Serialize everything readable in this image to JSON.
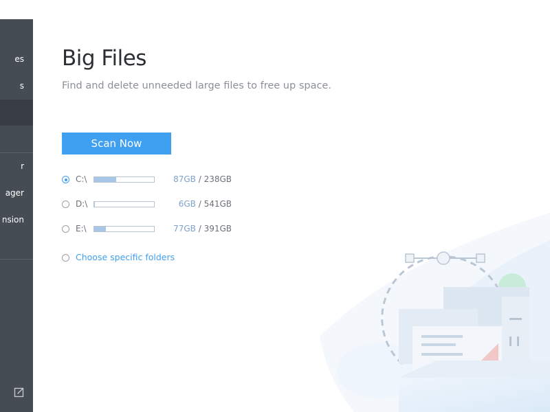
{
  "sidebar": {
    "items": [
      {
        "label": "es"
      },
      {
        "label": "s"
      },
      {
        "label": ""
      },
      {
        "label": ""
      },
      {
        "label": "r"
      },
      {
        "label": "ager"
      },
      {
        "label": "nsion"
      }
    ],
    "bottom_icon": "edit-icon"
  },
  "main": {
    "title": "Big Files",
    "subtitle": "Find and delete unneeded large files to free up space.",
    "scan_button": "Scan Now",
    "drives": [
      {
        "label": "C:\\",
        "used": "87GB",
        "separator": " / ",
        "total": "238GB",
        "usage_fraction": 0.37,
        "selected": true
      },
      {
        "label": "D:\\",
        "used": "6GB",
        "separator": " / ",
        "total": "541GB",
        "usage_fraction": 0.01,
        "selected": false
      },
      {
        "label": "E:\\",
        "used": "77GB",
        "separator": " / ",
        "total": "391GB",
        "usage_fraction": 0.2,
        "selected": false
      }
    ],
    "folders_option": "Choose specific folders"
  },
  "colors": {
    "accent": "#3f9ff0",
    "sidebar_bg": "#464c53",
    "bar_fill": "#a8c7e8"
  }
}
